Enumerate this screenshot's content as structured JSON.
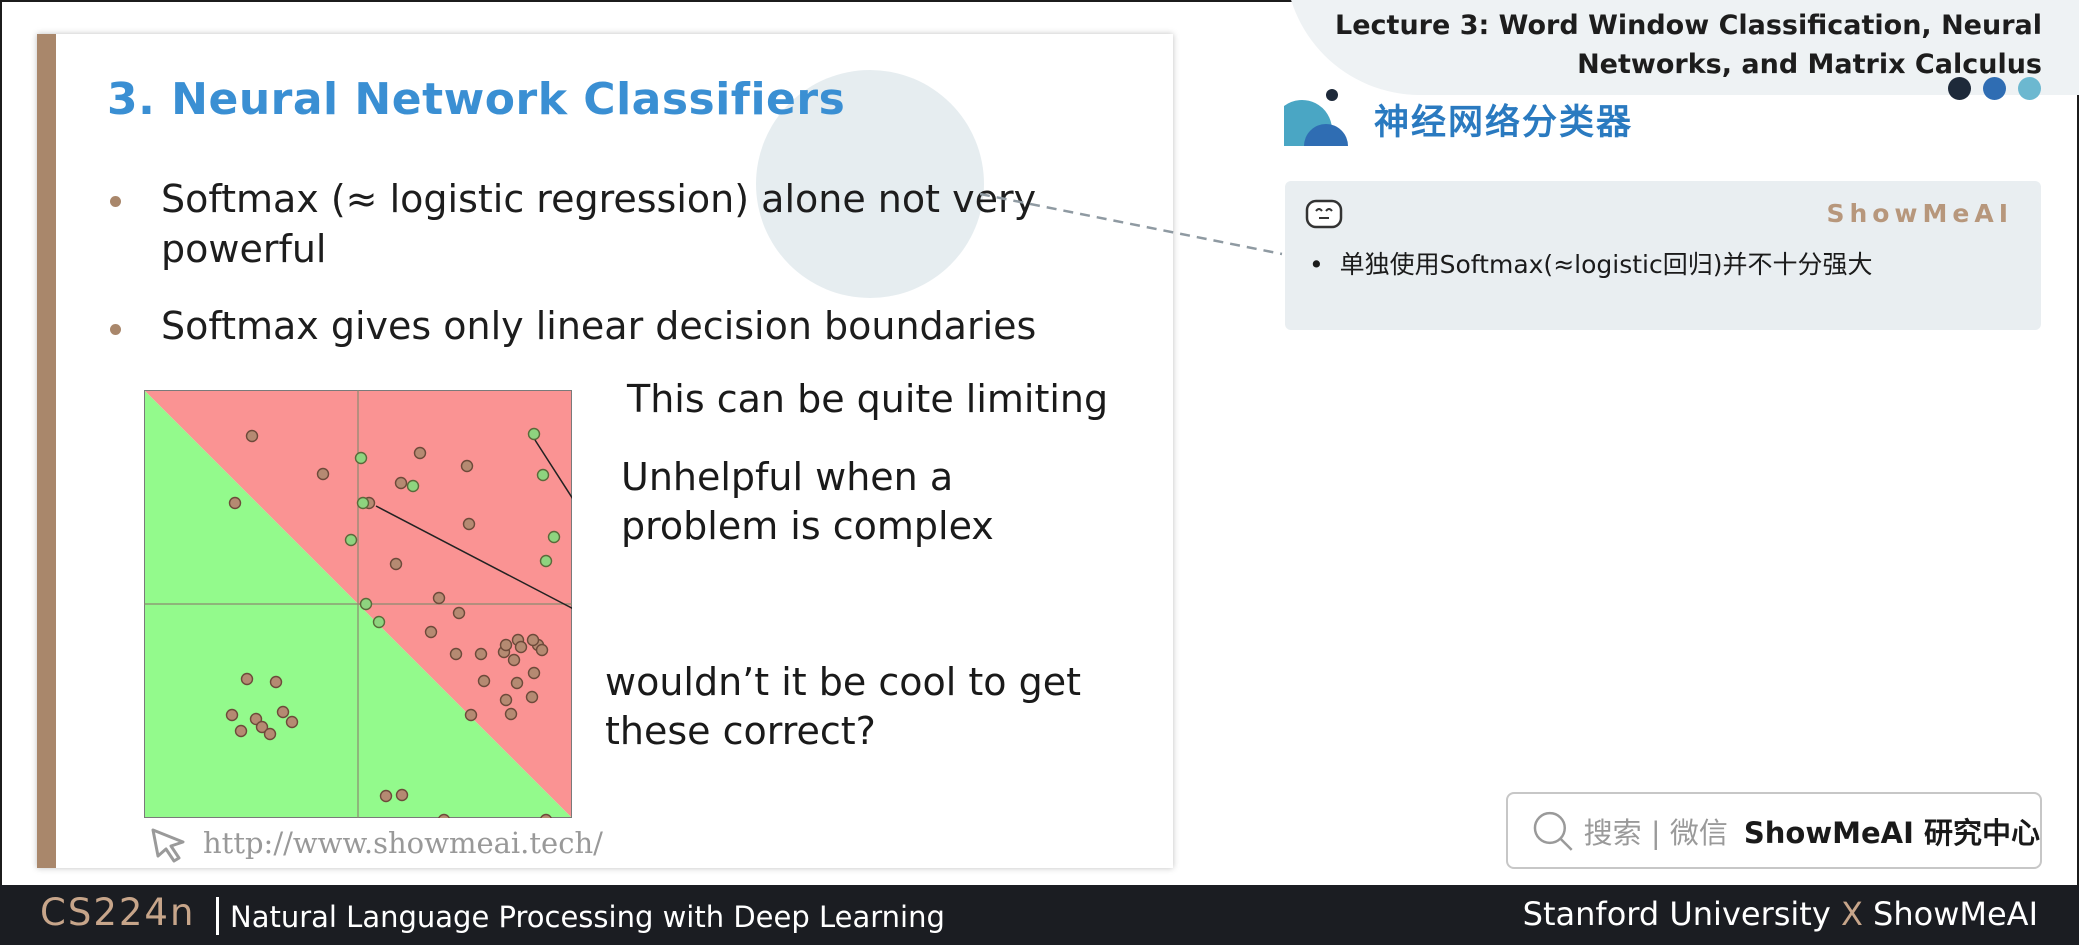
{
  "slide": {
    "title": "3. Neural Network Classifiers",
    "bullets": [
      "Softmax (≈ logistic regression) alone not very powerful",
      "Softmax gives only linear decision boundaries"
    ],
    "notes": {
      "limiting": "This can be quite limiting",
      "unhelpful_1": "Unhelpful when a",
      "unhelpful_2": "problem is complex",
      "cool_1": "wouldn’t it be cool to get",
      "cool_2": "these correct?"
    },
    "url": "http://www.showmeai.tech/",
    "colors": {
      "accent": "#3a8fd3",
      "bar": "#a9876b",
      "red_region": "#fa9393",
      "green_region": "#93fa8c"
    }
  },
  "header": {
    "lecture_line1": "Lecture 3:  Word Window Classification, Neural",
    "lecture_line2": "Networks, and Matrix Calculus"
  },
  "section": {
    "cn_title": "神经网络分类器"
  },
  "card": {
    "brand": "ShowMeAI",
    "bullet": "单独使用Softmax(≈logistic回归)并不十分强大"
  },
  "search": {
    "text": "搜索 | 微信",
    "brand": "ShowMeAI 研究中心"
  },
  "footer": {
    "course": "CS224n",
    "subtitle": "Natural Language Processing with Deep Learning",
    "right_main": "Stanford University",
    "right_x": "X",
    "right_brand": "ShowMeAI"
  }
}
